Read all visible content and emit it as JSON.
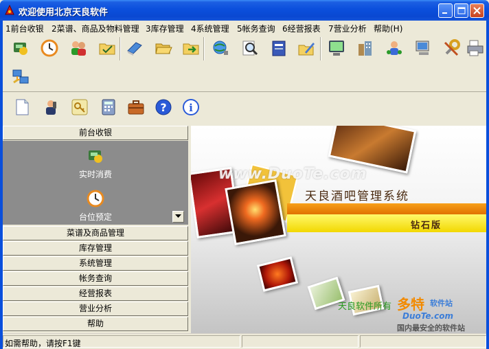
{
  "window": {
    "title": "欢迎使用北京天良软件"
  },
  "menu": [
    {
      "label": "1前台收银"
    },
    {
      "label": "2菜谱、商品及物料管理"
    },
    {
      "label": "3库存管理"
    },
    {
      "label": "4系统管理"
    },
    {
      "label": "5帐务查询"
    },
    {
      "label": "6经营报表"
    },
    {
      "label": "7营业分析"
    },
    {
      "label": "帮助(H)"
    }
  ],
  "toolbar": {
    "row1_icons": [
      "cashier-icon",
      "clock-icon",
      "users-icon",
      "folder-check-icon",
      "book-icon",
      "folder-open-icon",
      "folder-arrow-icon",
      "globe-search-icon",
      "magnifier-icon",
      "notebook-icon",
      "pencil-folder-icon",
      "monitor-icon",
      "buildings-icon",
      "network-user-icon",
      "computer-icon",
      "tools-icon",
      "printer-icon"
    ],
    "row2_icons": [
      "network-icon"
    ],
    "row3_icons": [
      "document-icon",
      "phone-user-icon",
      "key-icon",
      "calculator-icon",
      "briefcase-icon",
      "help-icon",
      "info-icon"
    ]
  },
  "nav": {
    "sections": [
      {
        "label": "前台收银"
      },
      {
        "label": "菜谱及商品管理"
      },
      {
        "label": "库存管理"
      },
      {
        "label": "系统管理"
      },
      {
        "label": "帐务查询"
      },
      {
        "label": "经营报表"
      },
      {
        "label": "营业分析"
      },
      {
        "label": "帮助"
      }
    ],
    "entries": [
      {
        "label": "实时消费",
        "icon": "cashier-icon"
      },
      {
        "label": "台位预定",
        "icon": "clock-icon"
      }
    ]
  },
  "banner": {
    "title": "天良酒吧管理系统",
    "edition": "钻石版",
    "copyright": "天良软件所有",
    "watermark_top": "www.DuoTe.com",
    "watermark_brand": "多特",
    "watermark_brand_sub": "软件站",
    "watermark_domain": "DuoTe.com",
    "watermark_slogan": "国内最安全的软件站"
  },
  "status": {
    "text": "如需帮助，请按F1键"
  }
}
